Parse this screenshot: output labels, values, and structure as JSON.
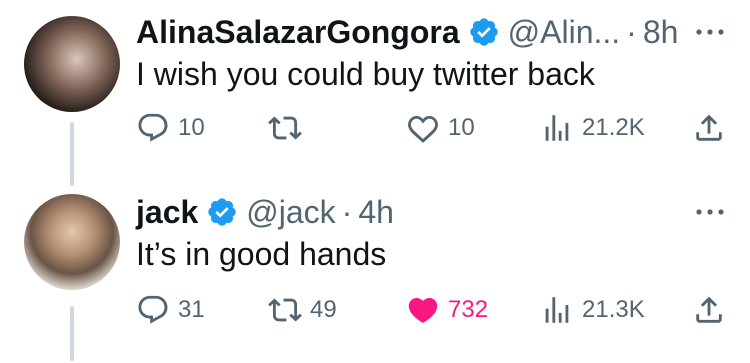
{
  "tweets": [
    {
      "name": "AlinaSalazarGongora",
      "handle": "@Alin...",
      "separator": "·",
      "time": "8h",
      "text": "I wish you could buy twitter back",
      "replies": "10",
      "retweets": "",
      "likes": "10",
      "liked": false,
      "views": "21.2K"
    },
    {
      "name": "jack",
      "handle": "@jack",
      "separator": "·",
      "time": "4h",
      "text": "It’s in good hands",
      "replies": "31",
      "retweets": "49",
      "likes": "732",
      "liked": true,
      "views": "21.3K"
    }
  ],
  "colors": {
    "verified": "#1d9bf0",
    "muted": "#536471",
    "like_active": "#f91880",
    "thread_line": "#cfd9de"
  },
  "icons": [
    "verified-badge-icon",
    "more-icon",
    "reply-icon",
    "retweet-icon",
    "heart-icon",
    "views-icon",
    "share-icon"
  ]
}
